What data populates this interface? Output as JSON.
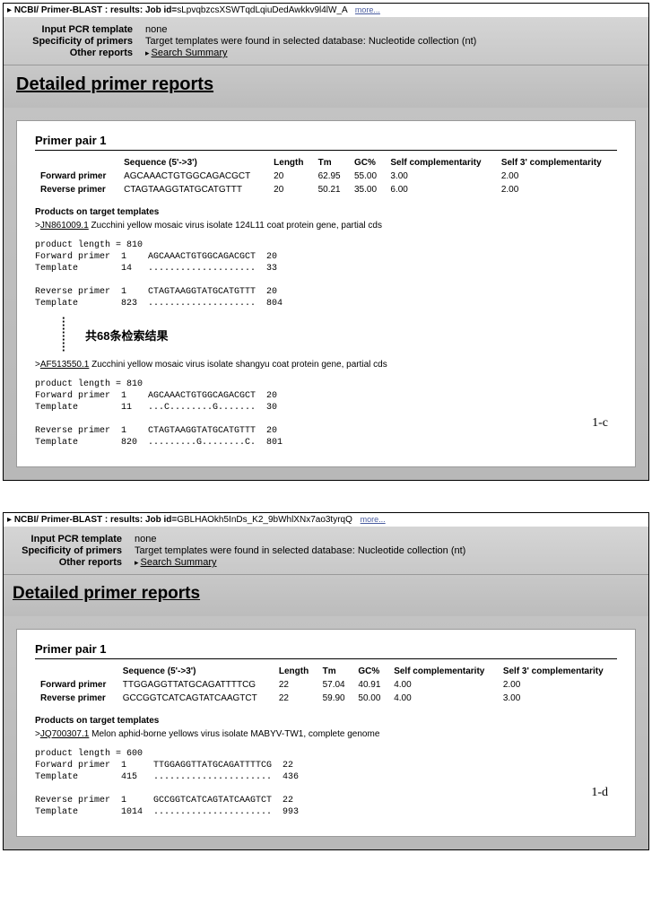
{
  "panel1": {
    "breadcrumb_prefix": "NCBI/ Primer-BLAST : results: Job id=",
    "job_id": "sLpvqbzcsXSWTqdLqiuDedAwkkv9l4lW_A",
    "more": "more...",
    "info": {
      "input_label": "Input PCR template",
      "input_value": "none",
      "spec_label": "Specificity of primers",
      "spec_value": "Target templates were found in selected database: Nucleotide collection (nt)",
      "other_label": "Other reports",
      "other_value": "Search Summary"
    },
    "section_title": "Detailed primer reports",
    "pair_title": "Primer pair 1",
    "headers": {
      "seq": "Sequence (5'->3')",
      "len": "Length",
      "tm": "Tm",
      "gc": "GC%",
      "self": "Self complementarity",
      "self3": "Self 3' complementarity"
    },
    "forward": {
      "label": "Forward primer",
      "seq": "AGCAAACTGTGGCAGACGCT",
      "len": "20",
      "tm": "62.95",
      "gc": "55.00",
      "self": "3.00",
      "self3": "2.00"
    },
    "reverse": {
      "label": "Reverse primer",
      "seq": "CTAGTAAGGTATGCATGTTT",
      "len": "20",
      "tm": "50.21",
      "gc": "35.00",
      "self": "6.00",
      "self3": "2.00"
    },
    "products_title": "Products on target templates",
    "target1": {
      "acc": "JN861009.1",
      "desc": " Zucchini yellow mosaic virus isolate 124L11 coat protein gene, partial cds"
    },
    "mono1": "product length = 810\nForward primer  1    AGCAAACTGTGGCAGACGCT  20\nTemplate        14   ....................  33\n\nReverse primer  1    CTAGTAAGGTATGCATGTTT  20\nTemplate        823  ....................  804",
    "divider_text": "共68条检索结果",
    "target2": {
      "acc": "AF513550.1",
      "desc": " Zucchini yellow mosaic virus isolate shangyu coat protein gene, partial cds"
    },
    "mono2": "product length = 810\nForward primer  1    AGCAAACTGTGGCAGACGCT  20\nTemplate        11   ...C........G.......  30\n\nReverse primer  1    CTAGTAAGGTATGCATGTTT  20\nTemplate        820  .........G........C.  801",
    "fig": "1-c"
  },
  "panel2": {
    "breadcrumb_prefix": "NCBI/ Primer-BLAST : results: Job id=",
    "job_id": "GBLHAOkh5InDs_K2_9bWhlXNx7ao3tyrqQ",
    "more": "more...",
    "info": {
      "input_label": "Input PCR template",
      "input_value": "none",
      "spec_label": "Specificity of primers",
      "spec_value": "Target templates were found in selected database: Nucleotide collection (nt)",
      "other_label": "Other reports",
      "other_value": "Search Summary"
    },
    "section_title": "Detailed primer reports",
    "pair_title": "Primer pair 1",
    "headers": {
      "seq": "Sequence (5'->3')",
      "len": "Length",
      "tm": "Tm",
      "gc": "GC%",
      "self": "Self complementarity",
      "self3": "Self 3' complementarity"
    },
    "forward": {
      "label": "Forward primer",
      "seq": "TTGGAGGTTATGCAGATTTTCG",
      "len": "22",
      "tm": "57.04",
      "gc": "40.91",
      "self": "4.00",
      "self3": "2.00"
    },
    "reverse": {
      "label": "Reverse primer",
      "seq": "GCCGGTCATCAGTATCAAGTCT",
      "len": "22",
      "tm": "59.90",
      "gc": "50.00",
      "self": "4.00",
      "self3": "3.00"
    },
    "products_title": "Products on target templates",
    "target1": {
      "acc": "JQ700307.1",
      "desc": " Melon aphid-borne yellows virus isolate MABYV-TW1, complete genome"
    },
    "mono1": "product length = 600\nForward primer  1     TTGGAGGTTATGCAGATTTTCG  22\nTemplate        415   ......................  436\n\nReverse primer  1     GCCGGTCATCAGTATCAAGTCT  22\nTemplate        1014  ......................  993",
    "fig": "1-d"
  }
}
